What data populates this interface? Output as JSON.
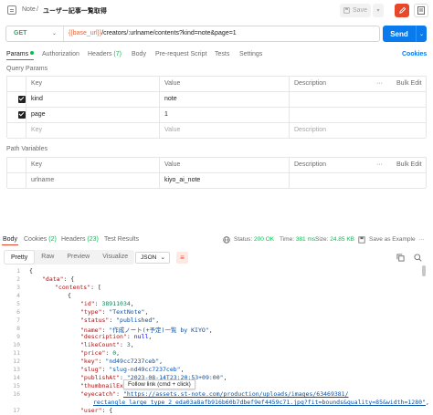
{
  "topbar": {
    "breadcrumb_parent": "Note",
    "breadcrumb_sep": "/",
    "breadcrumb_title": "ユーザー記事一覧取得",
    "save_label": "Save",
    "save_caret": "▾"
  },
  "request": {
    "method": "GET",
    "url_var": "{{base_url}}",
    "url_path": "/creators/:urlname/contents?kind=note&page=1",
    "send_label": "Send"
  },
  "tabs": {
    "params": "Params",
    "authorization": "Authorization",
    "headers": "Headers",
    "headers_count": "(7)",
    "body": "Body",
    "pre_request": "Pre-request Script",
    "tests": "Tests",
    "settings": "Settings",
    "cookies": "Cookies"
  },
  "query_params": {
    "title": "Query Params",
    "columns": {
      "key": "Key",
      "value": "Value",
      "description": "Description",
      "bulk_edit": "Bulk Edit"
    },
    "rows": [
      {
        "key": "kind",
        "value": "note",
        "description": ""
      },
      {
        "key": "page",
        "value": "1",
        "description": ""
      }
    ],
    "placeholder": {
      "key": "Key",
      "value": "Value",
      "description": "Description"
    }
  },
  "path_variables": {
    "title": "Path Variables",
    "columns": {
      "key": "Key",
      "value": "Value",
      "description": "Description",
      "bulk_edit": "Bulk Edit"
    },
    "rows": [
      {
        "key": "urlname",
        "value": "kiyo_ai_note",
        "description": ""
      }
    ]
  },
  "response": {
    "tabs": {
      "body": "Body",
      "cookies": "Cookies",
      "cookies_count": "(2)",
      "headers": "Headers",
      "headers_count": "(23)",
      "test_results": "Test Results"
    },
    "status_label": "Status:",
    "status_value": "200 OK",
    "time_label": "Time:",
    "time_value": "381 ms",
    "size_label": "Size:",
    "size_value": "24.85 KB",
    "save_example": "Save as Example",
    "view_modes": [
      "Pretty",
      "Raw",
      "Preview",
      "Visualize"
    ],
    "format": "JSON",
    "tooltip": "Follow link (cmd + click)",
    "line_numbers": [
      "1",
      "2",
      "3",
      "4",
      "5",
      "6",
      "7",
      "8",
      "9",
      "10",
      "11",
      "12",
      "13",
      "14",
      "15",
      "16",
      "",
      "17"
    ],
    "code": {
      "l1": "{",
      "l2k": "\"data\"",
      "l3k": "\"contents\"",
      "l4": "{",
      "l5k": "\"id\"",
      "l5v": "38911034",
      "l6k": "\"type\"",
      "l6v": "\"TextNote\"",
      "l7k": "\"status\"",
      "l7v": "\"published\"",
      "l8k": "\"name\"",
      "l8v": "\"作成ノート(+予定)一覧 by KIYO\"",
      "l9k": "\"description\"",
      "l9v": "null",
      "l10k": "\"likeCount\"",
      "l10v": "3",
      "l11k": "\"price\"",
      "l11v": "0",
      "l12k": "\"key\"",
      "l12v": "\"nd49cc7237ceb\"",
      "l13k": "\"slug\"",
      "l13v": "\"slug-nd49cc7237ceb\"",
      "l14k": "\"publishAt\"",
      "l14v": "\"2023-08-14T23:20:53+09:00\"",
      "l15k": "\"thumbnailExt",
      "l16k": "\"eyecatch\"",
      "l16v": "\"https://assets.st-note.com/production/uploads/images/63469381/",
      "l16b": "rectangle_large_type_2_eda03a8afb916b60b7dbef9ef4459c71.jpg?fit=bounds&quality=85&width=1280\"",
      "l17k": "\"user\""
    }
  },
  "colors": {
    "accent": "#e8482a",
    "send": "#097bed",
    "success": "#0cbb52",
    "variable": "#e6673a"
  },
  "icons": [
    "request-icon",
    "save-icon",
    "edit-icon",
    "doc-icon",
    "globe-icon",
    "copy-icon",
    "search-icon",
    "wrap-icon",
    "more-icon"
  ]
}
